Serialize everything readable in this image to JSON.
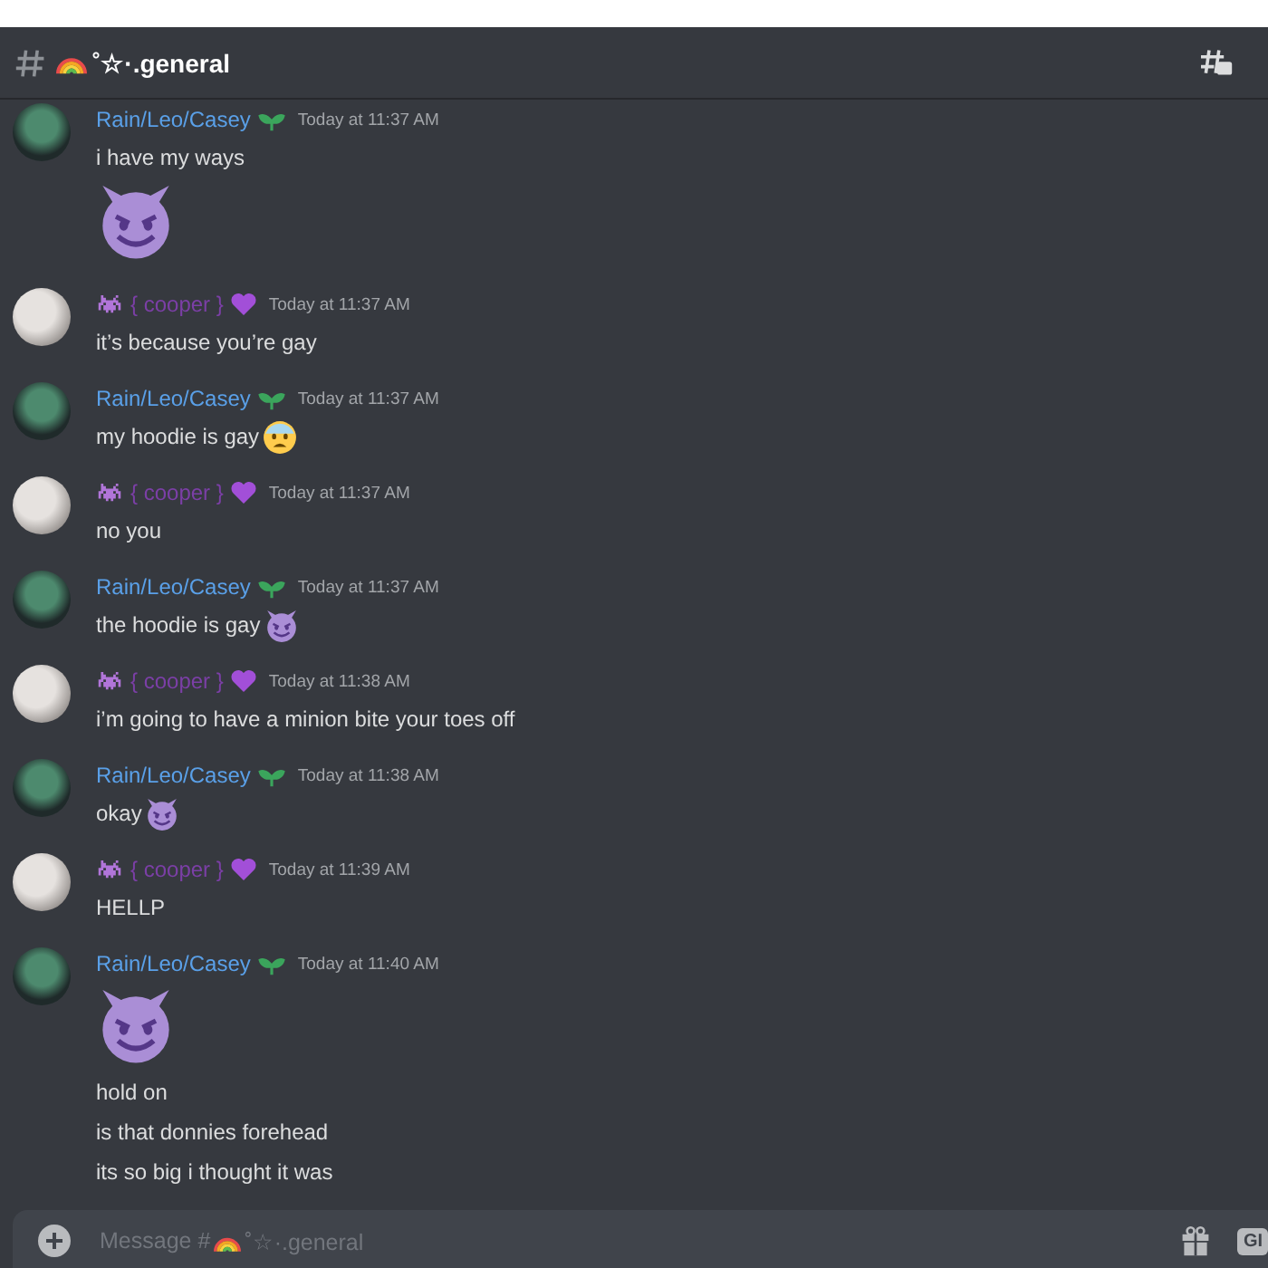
{
  "channel": {
    "name": "˚☆·.general"
  },
  "messages": [
    {
      "author": "Rain/Leo/Casey",
      "kind": "leo",
      "color": "#5aa0e8",
      "time": "Today at 11:37 AM",
      "lines": [
        {
          "text": "i have my ways",
          "kind": "plain"
        },
        {
          "kind": "jumbo"
        }
      ]
    },
    {
      "author": "{ cooper }",
      "kind": "cooper",
      "color": "#7b3fa6",
      "time": "Today at 11:37 AM",
      "lines": [
        {
          "text": "it’s because you’re gay",
          "kind": "plain"
        }
      ]
    },
    {
      "author": "Rain/Leo/Casey",
      "kind": "leo",
      "color": "#5aa0e8",
      "time": "Today at 11:37 AM",
      "lines": [
        {
          "text": "my hoodie is gay",
          "kind": "fearful"
        }
      ]
    },
    {
      "author": "{ cooper }",
      "kind": "cooper",
      "color": "#7b3fa6",
      "time": "Today at 11:37 AM",
      "lines": [
        {
          "text": "no you",
          "kind": "plain"
        }
      ]
    },
    {
      "author": "Rain/Leo/Casey",
      "kind": "leo",
      "color": "#5aa0e8",
      "time": "Today at 11:37 AM",
      "lines": [
        {
          "text": "the hoodie is gay",
          "kind": "devil"
        }
      ]
    },
    {
      "author": "{ cooper }",
      "kind": "cooper",
      "color": "#7b3fa6",
      "time": "Today at 11:38 AM",
      "lines": [
        {
          "text": "i’m going to have a minion bite your toes off",
          "kind": "plain"
        }
      ]
    },
    {
      "author": "Rain/Leo/Casey",
      "kind": "leo",
      "color": "#5aa0e8",
      "time": "Today at 11:38 AM",
      "lines": [
        {
          "text": "okay",
          "kind": "devil"
        }
      ]
    },
    {
      "author": "{ cooper }",
      "kind": "cooper",
      "color": "#7b3fa6",
      "time": "Today at 11:39 AM",
      "lines": [
        {
          "text": "HELLP",
          "kind": "plain"
        }
      ]
    },
    {
      "author": "Rain/Leo/Casey",
      "kind": "leo",
      "color": "#5aa0e8",
      "time": "Today at 11:40 AM",
      "lines": [
        {
          "kind": "jumbo"
        },
        {
          "text": "hold on",
          "kind": "plain"
        },
        {
          "text": "is that donnies forehead",
          "kind": "plain"
        },
        {
          "text": "its so big i thought it was",
          "kind": "plain"
        }
      ]
    }
  ],
  "composer": {
    "placeholder_start": "Message #",
    "placeholder_end": "˚☆·.general",
    "gif_label": "GI"
  }
}
